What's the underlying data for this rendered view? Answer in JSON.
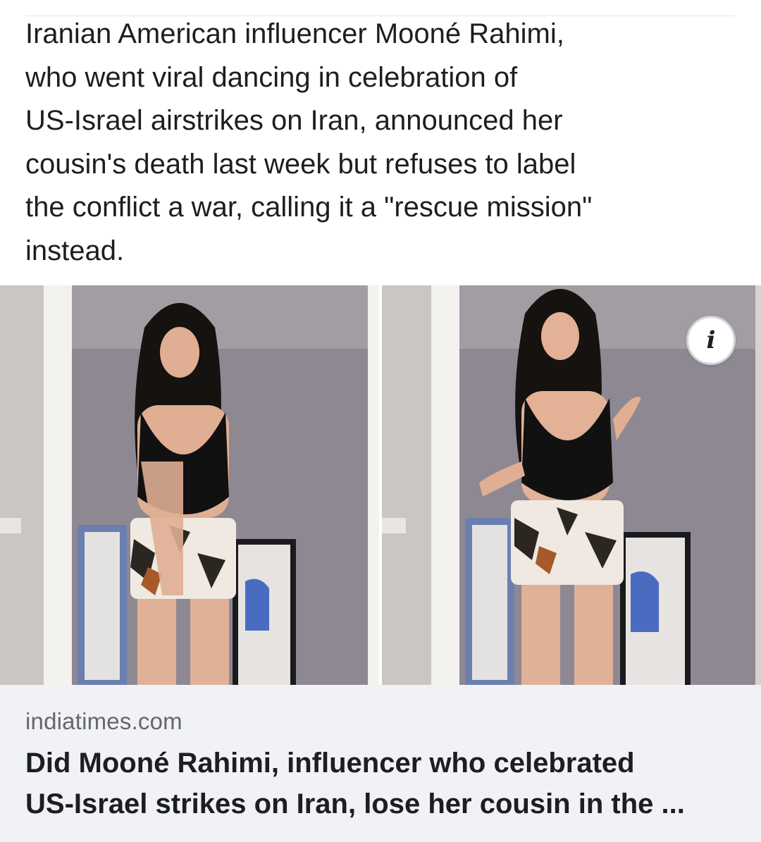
{
  "post": {
    "text": "Iranian American influencer Mooné Rahimi,\nwho went viral dancing in celebration of\nUS-Israel airstrikes on Iran, announced her\ncousin's death last week but refuses to label\nthe conflict a war, calling it a \"rescue mission\"\ninstead."
  },
  "link_preview": {
    "domain": "indiatimes.com",
    "title": "Did Mooné Rahimi, influencer who celebrated\nUS-Israel strikes on Iran, lose her cousin in the ...",
    "info_icon": "info-icon",
    "image": {
      "frames": [
        "woman-dancing-frame-1",
        "woman-dancing-frame-2"
      ]
    }
  },
  "colors": {
    "text_primary": "#1c1e21",
    "text_secondary": "#65676b",
    "card_background": "#f0f2f5",
    "wall": "#d8d4d1",
    "door_frame": "#f4f2ef"
  }
}
